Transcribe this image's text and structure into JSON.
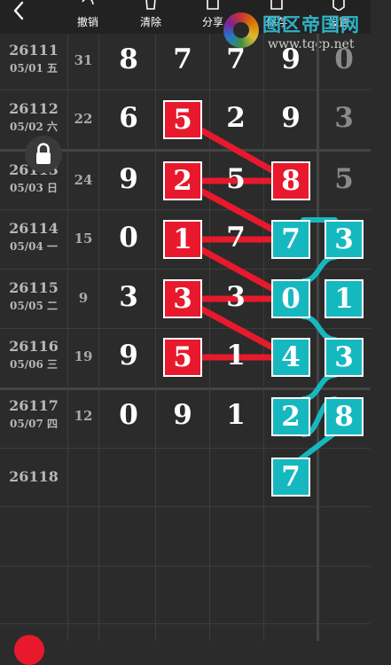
{
  "toolbar": {
    "back_icon": "chevron-left-icon",
    "buttons": [
      {
        "label": "撤销",
        "icon": "undo-icon"
      },
      {
        "label": "清除",
        "icon": "trash-icon"
      },
      {
        "label": "分享",
        "icon": "share-icon"
      },
      {
        "label": "保存",
        "icon": "save-icon"
      },
      {
        "label": "设置",
        "icon": "gear-icon"
      }
    ]
  },
  "watermark": {
    "title": "图区帝国网",
    "url": "www.tqcp.net"
  },
  "rows": [
    {
      "issue": "26111",
      "date": "05/01 五",
      "sum": "31",
      "digits": [
        "8",
        "7",
        "7",
        "9"
      ],
      "last": "0"
    },
    {
      "issue": "26112",
      "date": "05/02 六",
      "sum": "22",
      "digits": [
        "6",
        "5",
        "2",
        "9"
      ],
      "last": "3"
    },
    {
      "issue": "26113",
      "date": "05/03 日",
      "sum": "24",
      "digits": [
        "9",
        "2",
        "5",
        "8"
      ],
      "last": "5"
    },
    {
      "issue": "26114",
      "date": "05/04 一",
      "sum": "15",
      "digits": [
        "0",
        "1",
        "7",
        "7"
      ],
      "last": "3"
    },
    {
      "issue": "26115",
      "date": "05/05 二",
      "sum": "9",
      "digits": [
        "3",
        "3",
        "3",
        "0"
      ],
      "last": "1"
    },
    {
      "issue": "26116",
      "date": "05/06 三",
      "sum": "19",
      "digits": [
        "9",
        "5",
        "1",
        "4"
      ],
      "last": "3"
    },
    {
      "issue": "26117",
      "date": "05/07 四",
      "sum": "12",
      "digits": [
        "0",
        "9",
        "1",
        "2"
      ],
      "last": "8"
    },
    {
      "issue": "26118",
      "date": "",
      "sum": "",
      "digits": [
        "",
        "",
        "",
        "7"
      ],
      "last": ""
    }
  ],
  "colors": {
    "red": "#e8192c",
    "cyan": "#16b8c0",
    "background": "#2b2b2b"
  },
  "lock_icon": "lock-icon"
}
